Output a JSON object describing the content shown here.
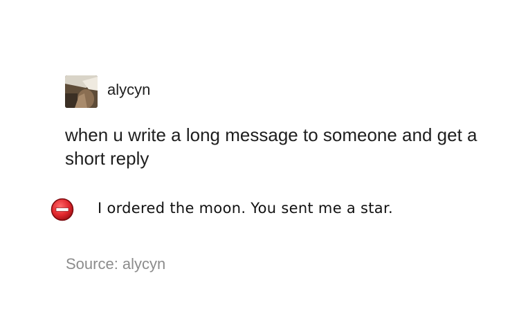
{
  "post": {
    "username": "alycyn",
    "body": "when u write a long message to someone and get a short reply",
    "error_message": "I ordered the moon. You sent me a star.",
    "source": "Source: alycyn"
  },
  "icons": {
    "avatar": "user-avatar-photo",
    "error": "stop-error-icon"
  },
  "colors": {
    "error_red": "#e0262c",
    "source_gray": "#8c8c8c"
  }
}
